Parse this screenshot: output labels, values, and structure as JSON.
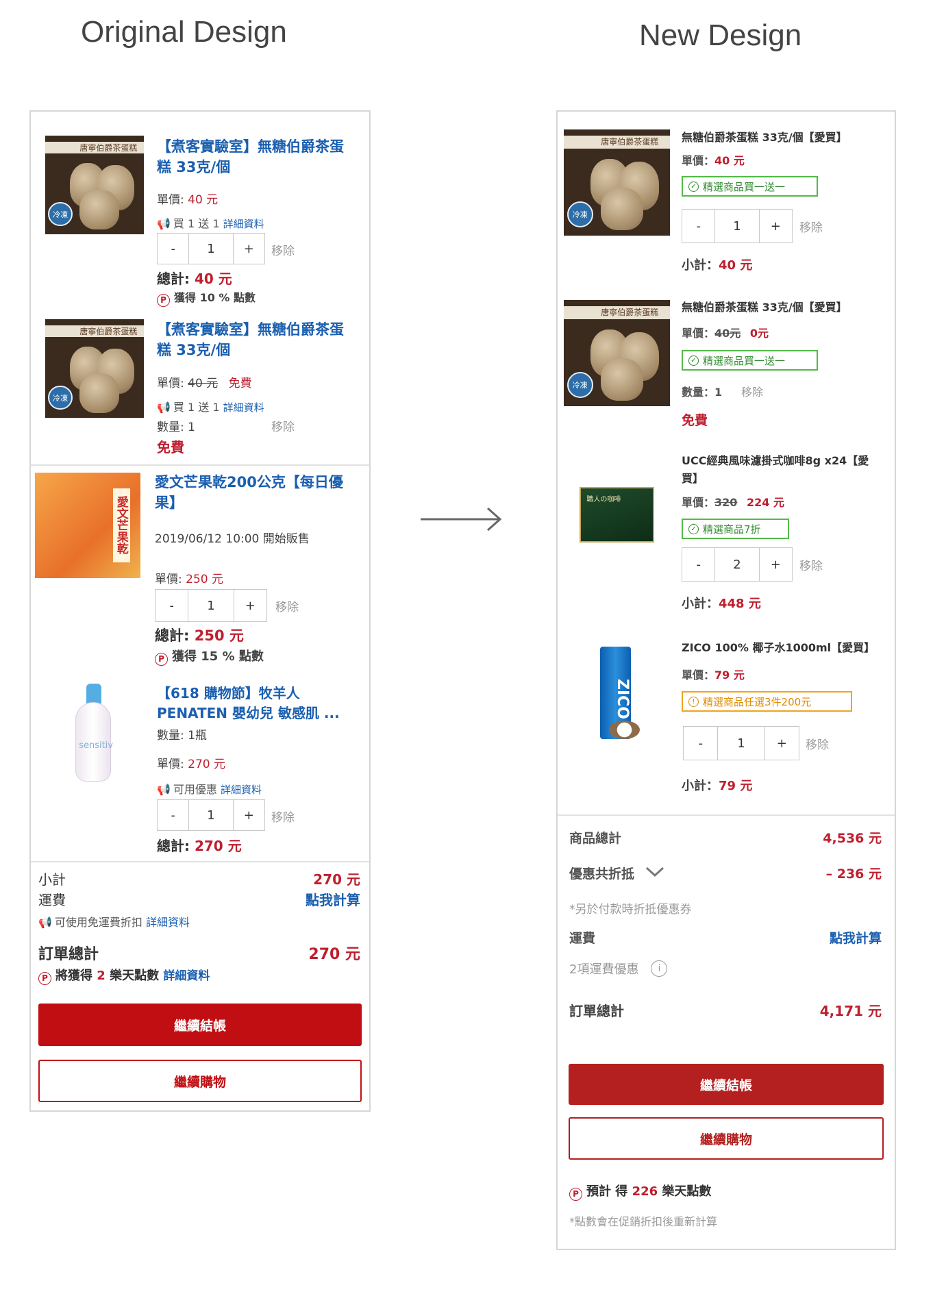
{
  "headings": {
    "left": "Original Design",
    "right": "New Design"
  },
  "arrow": "→",
  "original": {
    "items": [
      {
        "title": "【煮客實驗室】無糖伯爵茶蛋糕 33克/個",
        "image_band": "唐寧伯爵茶蛋糕",
        "image_seal": "冷凍",
        "unit_label": "單價:",
        "unit_price": "40 元",
        "promo_icon": "megaphone-icon",
        "promo_text": "買 1 送 1",
        "promo_link": "詳細資料",
        "qty": "1",
        "minus": "-",
        "plus": "+",
        "remove": "移除",
        "total_label": "總計:",
        "total_value": "40 元",
        "points_text": "獲得 10 % 點數"
      },
      {
        "title": "【煮客實驗室】無糖伯爵茶蛋糕 33克/個",
        "image_band": "唐寧伯爵茶蛋糕",
        "image_seal": "冷凍",
        "unit_label": "單價:",
        "unit_price_old": "40 元",
        "unit_price_free": "免費",
        "promo_text": "買 1 送 1",
        "promo_link": "詳細資料",
        "qty_text": "數量: 1",
        "remove": "移除",
        "free": "免費"
      },
      {
        "title": "愛文芒果乾200公克【每日優果】",
        "image_tag": "愛文芒果乾",
        "sale_start": "2019/06/12 10:00 開始販售",
        "unit_label": "單價:",
        "unit_price": "250 元",
        "qty": "1",
        "minus": "-",
        "plus": "+",
        "remove": "移除",
        "total_label": "總計:",
        "total_value": "250 元",
        "points_text": "獲得 15 % 點數"
      },
      {
        "title": "【618 購物節】牧羊人 PENATEN 嬰幼兒 敏感肌 ...",
        "image_label": "sensitiv",
        "qty_text": "數量: 1瓶",
        "unit_label": "單價:",
        "unit_price": "270 元",
        "promo_text": "可用優惠",
        "promo_link": "詳細資料",
        "qty": "1",
        "minus": "-",
        "plus": "+",
        "remove": "移除",
        "total_label": "總計:",
        "total_value": "270 元"
      }
    ],
    "summary": {
      "subtotal_label": "小計",
      "subtotal_value": "270 元",
      "shipping_label": "運費",
      "shipping_value": "點我計算",
      "shipping_note": "可使用免運費折扣",
      "shipping_link": "詳細資料",
      "order_total_label": "訂單總計",
      "order_total_value": "270 元",
      "points_prefix": "將獲得",
      "points_value": "2",
      "points_suffix": "樂天點數",
      "points_link": "詳細資料"
    },
    "buttons": {
      "checkout": "繼續結帳",
      "continue": "繼續購物"
    }
  },
  "redesign": {
    "items": [
      {
        "title": "無糖伯爵茶蛋糕 33克/個【愛買】",
        "image_band": "唐寧伯爵茶蛋糕",
        "image_seal": "冷凍",
        "unit_label": "單價：",
        "unit_price": "40 元",
        "badge": "精選商品買一送一",
        "qty": "1",
        "minus": "-",
        "plus": "+",
        "remove": "移除",
        "subtotal_label": "小計：",
        "subtotal_value": "40 元"
      },
      {
        "title": "無糖伯爵茶蛋糕 33克/個【愛買】",
        "image_band": "唐寧伯爵茶蛋糕",
        "image_seal": "冷凍",
        "unit_label": "單價：",
        "unit_price_old": "40元",
        "unit_price_new": "0元",
        "badge": "精選商品買一送一",
        "qty_text": "數量：1",
        "remove": "移除",
        "free": "免費"
      },
      {
        "title": "UCC經典風味濾掛式咖啡8g x24【愛買】",
        "image_label": "職人の咖啡",
        "unit_label": "單價：",
        "unit_price_old": "320",
        "unit_price_new": "224 元",
        "badge": "精選商品7折",
        "qty": "2",
        "minus": "-",
        "plus": "+",
        "remove": "移除",
        "subtotal_label": "小計：",
        "subtotal_value": "448 元"
      },
      {
        "title": "ZICO 100% 椰子水1000ml【愛買】",
        "image_label": "ZICO",
        "unit_label": "單價：",
        "unit_price": "79 元",
        "badge": "精選商品任選3件200元",
        "qty": "1",
        "minus": "-",
        "plus": "+",
        "remove": "移除",
        "subtotal_label": "小計：",
        "subtotal_value": "79 元"
      }
    ],
    "summary": {
      "goods_total_label": "商品總計",
      "goods_total_value": "4,536 元",
      "discount_label": "優惠共折抵",
      "discount_value": "– 236 元",
      "discount_note": "*另於付款時折抵優惠券",
      "shipping_label": "運費",
      "shipping_value": "點我計算",
      "shipping_note": "2項運費優惠",
      "order_total_label": "訂單總計",
      "order_total_value": "4,171 元"
    },
    "buttons": {
      "checkout": "繼續結帳",
      "continue": "繼續購物"
    },
    "points": {
      "prefix": "預計 得",
      "value": "226",
      "suffix": "樂天點數",
      "note": "*點數會在促銷折扣後重新計算"
    }
  },
  "colors": {
    "brand_red": "#c10e13",
    "link_blue": "#1b5fb0",
    "promo_green": "#54b948",
    "promo_orange": "#f0a41e"
  }
}
